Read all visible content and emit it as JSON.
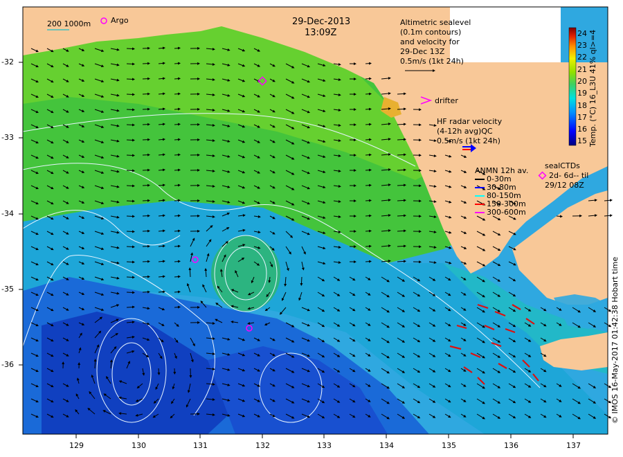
{
  "header": {
    "date": "29-Dec-2013",
    "time": "13:09Z"
  },
  "legend": {
    "depth_label": "200  1000m",
    "argo_label": "Argo",
    "altimetry_lines": [
      "Altimetric sealevel",
      "(0.1m contours)",
      "and velocity for",
      "29-Dec 13Z",
      "0.5m/s (1kt 24h)"
    ],
    "drifter_label": "drifter",
    "hf_lines": [
      "HF radar velocity",
      "(4-12h avg)QC",
      "0.5m/s (1kt 24h)"
    ],
    "anmn_title": "ANMN 12h av.",
    "anmn_items": [
      {
        "label": "0-30m",
        "color": "#000000"
      },
      {
        "label": "30-80m",
        "color": "#0000ff"
      },
      {
        "label": "80-150m",
        "color": "#00ffff"
      },
      {
        "label": "150-300m",
        "color": "#ff0000"
      },
      {
        "label": "300-600m",
        "color": "#ff00ff"
      }
    ],
    "sealctd_lines": [
      "sealCTDs",
      "2d- 6d-- til",
      "29/12 08Z"
    ]
  },
  "colorbar": {
    "title": "Temp. (°C) 16_L3U 41% ql>=4",
    "labels": [
      "24",
      "23",
      "22",
      "21",
      "20",
      "19",
      "18",
      "17",
      "16",
      "15"
    ]
  },
  "axes": {
    "x_ticks": [
      "129",
      "130",
      "131",
      "132",
      "133",
      "134",
      "135",
      "136",
      "137"
    ],
    "y_ticks": [
      "-32",
      "-33",
      "-34",
      "-35",
      "-36"
    ]
  },
  "credit": "© IMOS 16-May-2017 01:42:38 Hobart time",
  "colors": {
    "land": "#f8c898",
    "argo": "#ff00ff",
    "hf_radar_1": "#0000ff",
    "hf_radar_2": "#ff0000"
  }
}
